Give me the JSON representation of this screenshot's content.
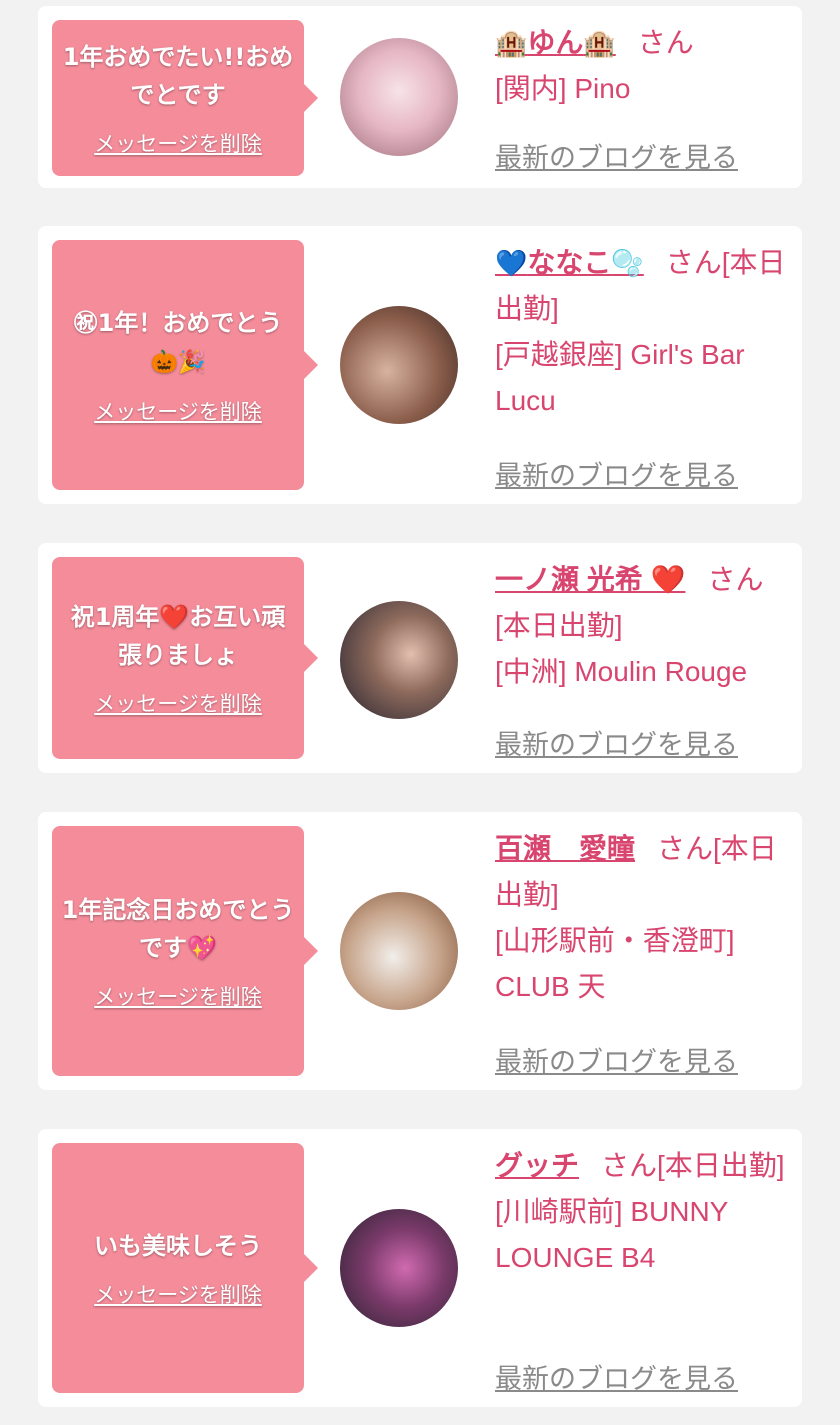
{
  "entries": [
    {
      "message": "1年おめでたい!!おめでとです",
      "message_emoji": "",
      "delete_label": "メッセージを削除",
      "name_prefix_icon": "🏨",
      "name": "ゆん",
      "name_suffix_icon": "🏨",
      "honorific": "さん",
      "status": "",
      "area": "[関内]",
      "shop": "Pino",
      "blog_label": "最新のブログを見る",
      "avatar_colors": [
        "#f3d6df",
        "#b07a88"
      ]
    },
    {
      "message": "㊗1年！おめでとう",
      "message_emoji": "🎃🎉",
      "delete_label": "メッセージを削除",
      "name_prefix_icon": "💙",
      "name": "ななこ",
      "name_suffix_icon": "🫧",
      "honorific": "さん",
      "status": "[本日出勤]",
      "area": "[戸越銀座]",
      "shop": "Girl's Bar Lucu",
      "blog_label": "最新のブログを見る",
      "avatar_colors": [
        "#6b4a3a",
        "#c9a08a"
      ]
    },
    {
      "message": "祝1周年❤️お互い頑張りましょ",
      "message_emoji": "",
      "delete_label": "メッセージを削除",
      "name_prefix_icon": "",
      "name": "一ノ瀬 光希 ❤️",
      "name_suffix_icon": "",
      "honorific": "さん",
      "status": "[本日出勤]",
      "area": "[中洲]",
      "shop": "Moulin Rouge",
      "blog_label": "最新のブログを見る",
      "avatar_colors": [
        "#2c2a3a",
        "#c89a84"
      ]
    },
    {
      "message": "1年記念日おめでとうです💖",
      "message_emoji": "",
      "delete_label": "メッセージを削除",
      "name_prefix_icon": "",
      "name": "百瀬　愛瞳",
      "name_suffix_icon": "",
      "honorific": "さん",
      "status": "[本日出勤]",
      "area": "[山形駅前・香澄町]",
      "shop": "CLUB 天",
      "blog_label": "最新のブログを見る",
      "avatar_colors": [
        "#e8e2dc",
        "#7a4e34"
      ]
    },
    {
      "message": "いも美味しそう",
      "message_emoji": "",
      "delete_label": "メッセージを削除",
      "name_prefix_icon": "",
      "name": "グッチ",
      "name_suffix_icon": "",
      "honorific": "さん",
      "status": "[本日出勤]",
      "area": "[川崎駅前]",
      "shop": "BUNNY LOUNGE B4",
      "blog_label": "最新のブログを見る",
      "avatar_colors": [
        "#3a2d3a",
        "#b85a9a"
      ]
    }
  ]
}
